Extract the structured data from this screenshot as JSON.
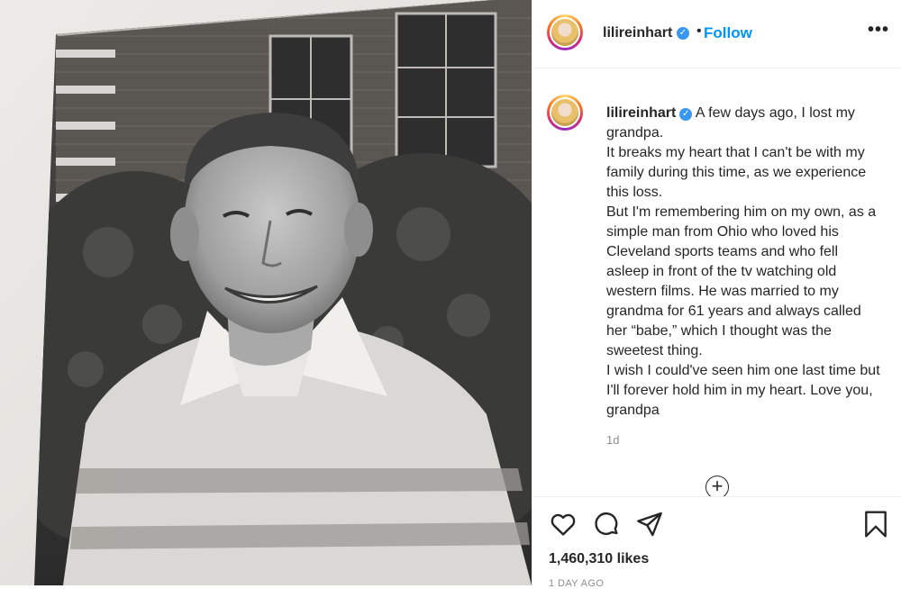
{
  "post": {
    "username": "lilireinhart",
    "follow_label": "Follow",
    "separator": "•",
    "more_icon": "more-options-icon",
    "verified_icon": "verified-badge-icon"
  },
  "caption": {
    "username": "lilireinhart",
    "lines": [
      "A few days ago, I lost my grandpa.",
      "It breaks my heart that I can't be with my family during this time, as we experience this loss.",
      "But I'm remembering him on my own, as a simple man from Ohio who loved his Cleveland sports teams and who fell asleep in front of the tv watching old western films. He was married to my grandma for 61 years and always called her “babe,” which I thought was the sweetest thing.",
      "I wish I could've seen him one last time but I'll forever hold him in my heart. Love you, grandpa"
    ],
    "age": "1d"
  },
  "actions": {
    "likes": "1,460,310 likes",
    "timestamp": "1 DAY AGO",
    "icons": [
      "heart-icon",
      "comment-icon",
      "share-icon",
      "bookmark-icon",
      "load-more-icon"
    ]
  },
  "colors": {
    "link": "#0095f6",
    "text": "#262626",
    "muted": "#8e8e8e",
    "verified": "#3897f0"
  }
}
